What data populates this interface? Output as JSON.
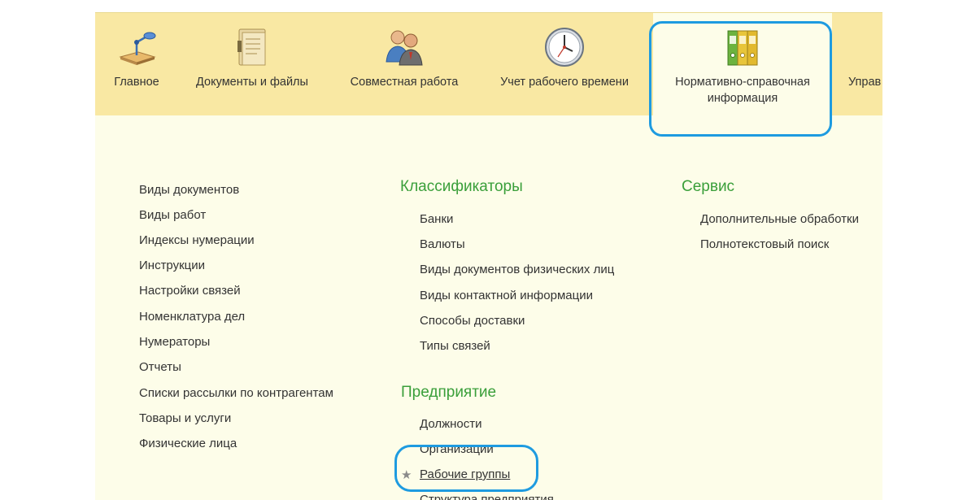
{
  "toolbar": {
    "items": [
      {
        "label": "Главное",
        "icon": "desk-lamp-icon"
      },
      {
        "label": "Документы и файлы",
        "icon": "documents-folder-icon"
      },
      {
        "label": "Совместная работа",
        "icon": "people-icon"
      },
      {
        "label": "Учет рабочего времени",
        "icon": "clock-icon"
      },
      {
        "label": "Нормативно-справочная",
        "label2": "информация",
        "icon": "binders-icon"
      },
      {
        "label": "Управ",
        "icon": ""
      }
    ]
  },
  "left_list": [
    "Виды документов",
    "Виды работ",
    "Индексы нумерации",
    "Инструкции",
    "Настройки связей",
    "Номенклатура дел",
    "Нумераторы",
    "Отчеты",
    "Списки рассылки по контрагентам",
    "Товары и услуги",
    "Физические лица"
  ],
  "classifiers": {
    "title": "Классификаторы",
    "items": [
      "Банки",
      "Валюты",
      "Виды документов физических лиц",
      "Виды контактной информации",
      "Способы доставки",
      "Типы связей"
    ]
  },
  "enterprise": {
    "title": "Предприятие",
    "items": [
      "Должности",
      "Организации",
      "Рабочие группы",
      "Структура предприятия"
    ]
  },
  "service": {
    "title": "Сервис",
    "items": [
      "Дополнительные обработки",
      "Полнотекстовый поиск"
    ]
  },
  "colors": {
    "toolbar_bg": "#f9e8a3",
    "content_bg": "#fdfde9",
    "section_header": "#3a9f3a",
    "highlight": "#1e9be0"
  }
}
